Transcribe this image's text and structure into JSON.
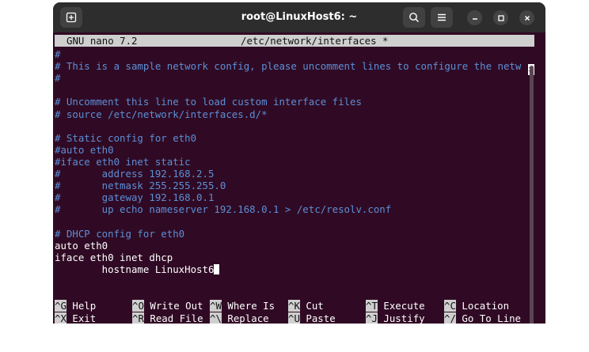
{
  "window": {
    "title": "root@LinuxHost6: ~"
  },
  "nano": {
    "version": "GNU nano 7.2",
    "filename": "/etc/network/interfaces *",
    "more_marker": ">"
  },
  "lines": [
    {
      "text": "#",
      "type": "comment"
    },
    {
      "text": "# This is a sample network config, please uncomment lines to configure the netw",
      "type": "comment"
    },
    {
      "text": "#",
      "type": "comment"
    },
    {
      "text": "",
      "type": "plain"
    },
    {
      "text": "# Uncomment this line to load custom interface files",
      "type": "comment"
    },
    {
      "text": "# source /etc/network/interfaces.d/*",
      "type": "comment"
    },
    {
      "text": "",
      "type": "plain"
    },
    {
      "text": "# Static config for eth0",
      "type": "comment"
    },
    {
      "text": "#auto eth0",
      "type": "comment"
    },
    {
      "text": "#iface eth0 inet static",
      "type": "comment"
    },
    {
      "text": "#       address 192.168.2.5",
      "type": "comment"
    },
    {
      "text": "#       netmask 255.255.255.0",
      "type": "comment"
    },
    {
      "text": "#       gateway 192.168.0.1",
      "type": "comment"
    },
    {
      "text": "#       up echo nameserver 192.168.0.1 > /etc/resolv.conf",
      "type": "comment"
    },
    {
      "text": "",
      "type": "plain"
    },
    {
      "text": "# DHCP config for eth0",
      "type": "comment"
    },
    {
      "text": "auto eth0",
      "type": "plain"
    },
    {
      "text": "iface eth0 inet dhcp",
      "type": "plain"
    },
    {
      "text": "        hostname LinuxHost6",
      "type": "plain",
      "cursor": true
    }
  ],
  "shortcuts": {
    "row1": [
      {
        "key": "^G",
        "label": "Help"
      },
      {
        "key": "^O",
        "label": "Write Out"
      },
      {
        "key": "^W",
        "label": "Where Is"
      },
      {
        "key": "^K",
        "label": "Cut"
      },
      {
        "key": "^T",
        "label": "Execute"
      },
      {
        "key": "^C",
        "label": "Location"
      }
    ],
    "row2": [
      {
        "key": "^X",
        "label": "Exit"
      },
      {
        "key": "^R",
        "label": "Read File"
      },
      {
        "key": "^\\",
        "label": "Replace"
      },
      {
        "key": "^U",
        "label": "Paste"
      },
      {
        "key": "^J",
        "label": "Justify"
      },
      {
        "key": "^/",
        "label": "Go To Line"
      }
    ]
  },
  "icons": {
    "new_tab": "new-tab-icon",
    "search": "search-icon",
    "menu": "hamburger-menu-icon",
    "minimize": "minimize-icon",
    "maximize": "maximize-icon",
    "close": "close-icon"
  },
  "colors": {
    "terminal_bg": "#300a24",
    "titlebar_bg": "#2d2d2d",
    "comment": "#5c8fd6",
    "nano_bar": "#cfcfcf"
  }
}
